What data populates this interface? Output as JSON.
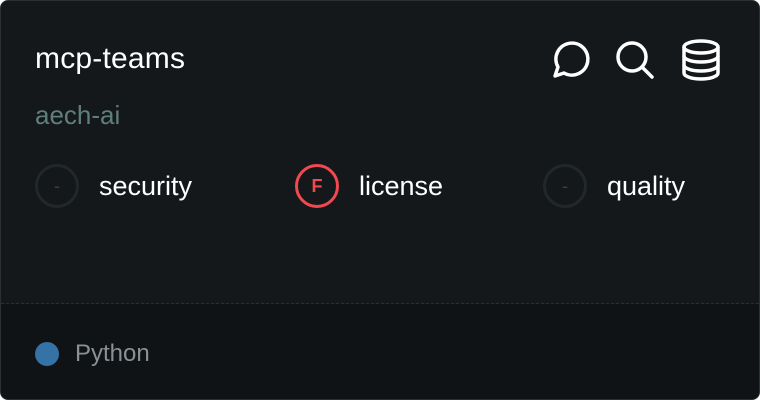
{
  "repo": {
    "name": "mcp-teams",
    "owner": "aech-ai"
  },
  "actions": [
    {
      "icon": "chat-bubble-icon"
    },
    {
      "icon": "search-icon"
    },
    {
      "icon": "database-icon"
    }
  ],
  "scores": [
    {
      "grade": "-",
      "label": "security",
      "status": "none"
    },
    {
      "grade": "F",
      "label": "license",
      "status": "fail"
    },
    {
      "grade": "-",
      "label": "quality",
      "status": "none"
    }
  ],
  "language": {
    "name": "Python",
    "color": "#3572a5"
  },
  "colors": {
    "background": "#14181b",
    "footer": "#0f1315",
    "owner_text": "#5f7f7a",
    "fail": "#f0494f"
  }
}
